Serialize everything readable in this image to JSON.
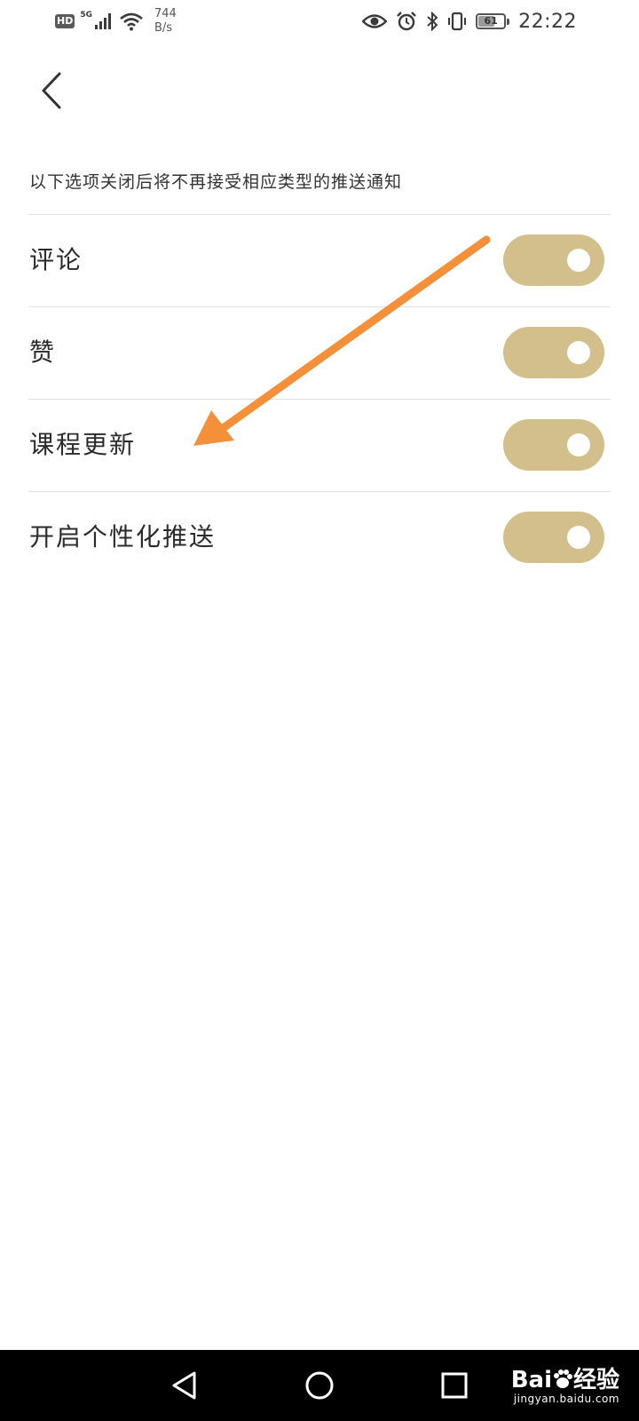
{
  "status_bar": {
    "hd": "HD",
    "network": "5G",
    "speed_value": "744",
    "speed_unit": "B/s",
    "battery_level": "61",
    "time": "22:22",
    "icons": [
      "hd-icon",
      "signal-icon",
      "wifi-icon",
      "eye-icon",
      "alarm-icon",
      "bluetooth-icon",
      "vibrate-icon",
      "battery-icon"
    ]
  },
  "header": {
    "back_icon": "chevron-left-icon"
  },
  "hint": "以下选项关闭后将不再接受相应类型的推送通知",
  "settings": [
    {
      "label": "评论",
      "enabled": true
    },
    {
      "label": "赞",
      "enabled": true
    },
    {
      "label": "课程更新",
      "enabled": true
    },
    {
      "label": "开启个性化推送",
      "enabled": true
    }
  ],
  "colors": {
    "toggle_on": "#d2bf8c",
    "annotation_arrow": "#f5903a",
    "divider": "#e2e2e2"
  },
  "nav_bar": {
    "icons": [
      "back-triangle-icon",
      "home-circle-icon",
      "recents-square-icon"
    ]
  },
  "watermark": {
    "brand": "Bai",
    "brand2": "经验",
    "sub": "jingyan.baidu.com"
  }
}
